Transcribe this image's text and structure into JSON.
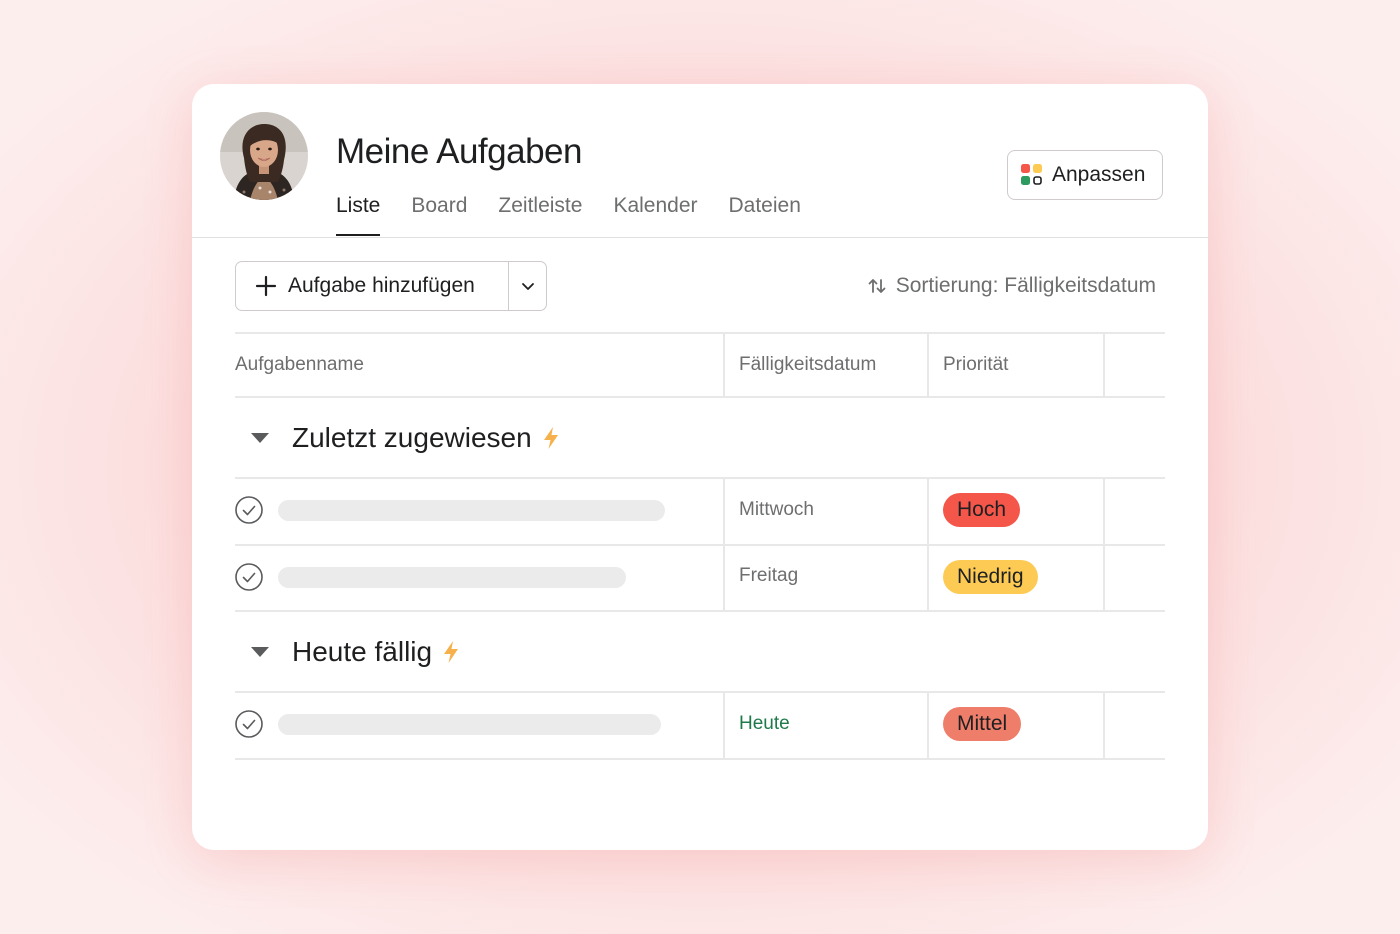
{
  "header": {
    "title": "Meine Aufgaben",
    "customize_label": "Anpassen",
    "customize_icon": "apps-grid-icon"
  },
  "tabs": [
    {
      "label": "Liste",
      "active": true
    },
    {
      "label": "Board",
      "active": false
    },
    {
      "label": "Zeitleiste",
      "active": false
    },
    {
      "label": "Kalender",
      "active": false
    },
    {
      "label": "Dateien",
      "active": false
    }
  ],
  "toolbar": {
    "add_task_label": "Aufgabe hinzufügen",
    "sort_label": "Sortierung: Fälligkeitsdatum"
  },
  "table": {
    "columns": {
      "name": "Aufgabenname",
      "due": "Fälligkeitsdatum",
      "priority": "Priorität"
    },
    "sections": [
      {
        "title": "Zuletzt zugewiesen",
        "tasks": [
          {
            "due": "Mittwoch",
            "priority": "Hoch",
            "priority_color": "#f5564a"
          },
          {
            "due": "Freitag",
            "priority": "Niedrig",
            "priority_color": "#fdcb54"
          }
        ]
      },
      {
        "title": "Heute fällig",
        "tasks": [
          {
            "due": "Heute",
            "due_color": "#1f7a4a",
            "priority": "Mittel",
            "priority_color": "#ee7d6a"
          }
        ]
      }
    ]
  },
  "colors": {
    "bolt": "#f7b14c",
    "due_today": "#1f7a4a",
    "placeholder": "#ebebeb"
  }
}
